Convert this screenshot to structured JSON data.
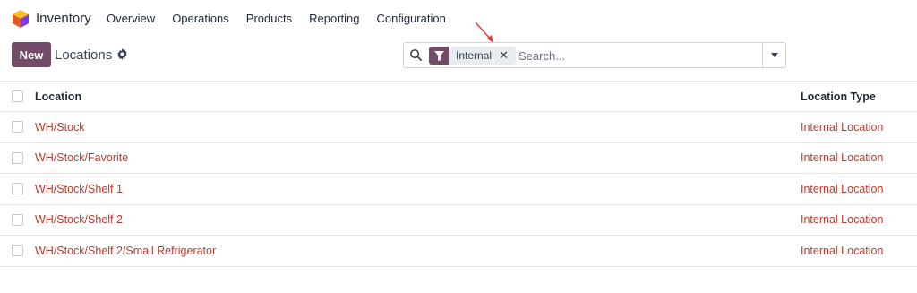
{
  "app": {
    "name": "Inventory",
    "brand_color": "#714b67",
    "link_color": "#c0392b"
  },
  "nav": {
    "items": [
      "Overview",
      "Operations",
      "Products",
      "Reporting",
      "Configuration"
    ]
  },
  "control_panel": {
    "new_label": "New",
    "title": "Locations"
  },
  "search": {
    "facet_label": "Internal",
    "placeholder": "Search..."
  },
  "table": {
    "columns": [
      "Location",
      "Location Type"
    ],
    "rows": [
      {
        "location": "WH/Stock",
        "type": "Internal Location"
      },
      {
        "location": "WH/Stock/Favorite",
        "type": "Internal Location"
      },
      {
        "location": "WH/Stock/Shelf 1",
        "type": "Internal Location"
      },
      {
        "location": "WH/Stock/Shelf 2",
        "type": "Internal Location"
      },
      {
        "location": "WH/Stock/Shelf 2/Small Refrigerator",
        "type": "Internal Location"
      }
    ]
  }
}
